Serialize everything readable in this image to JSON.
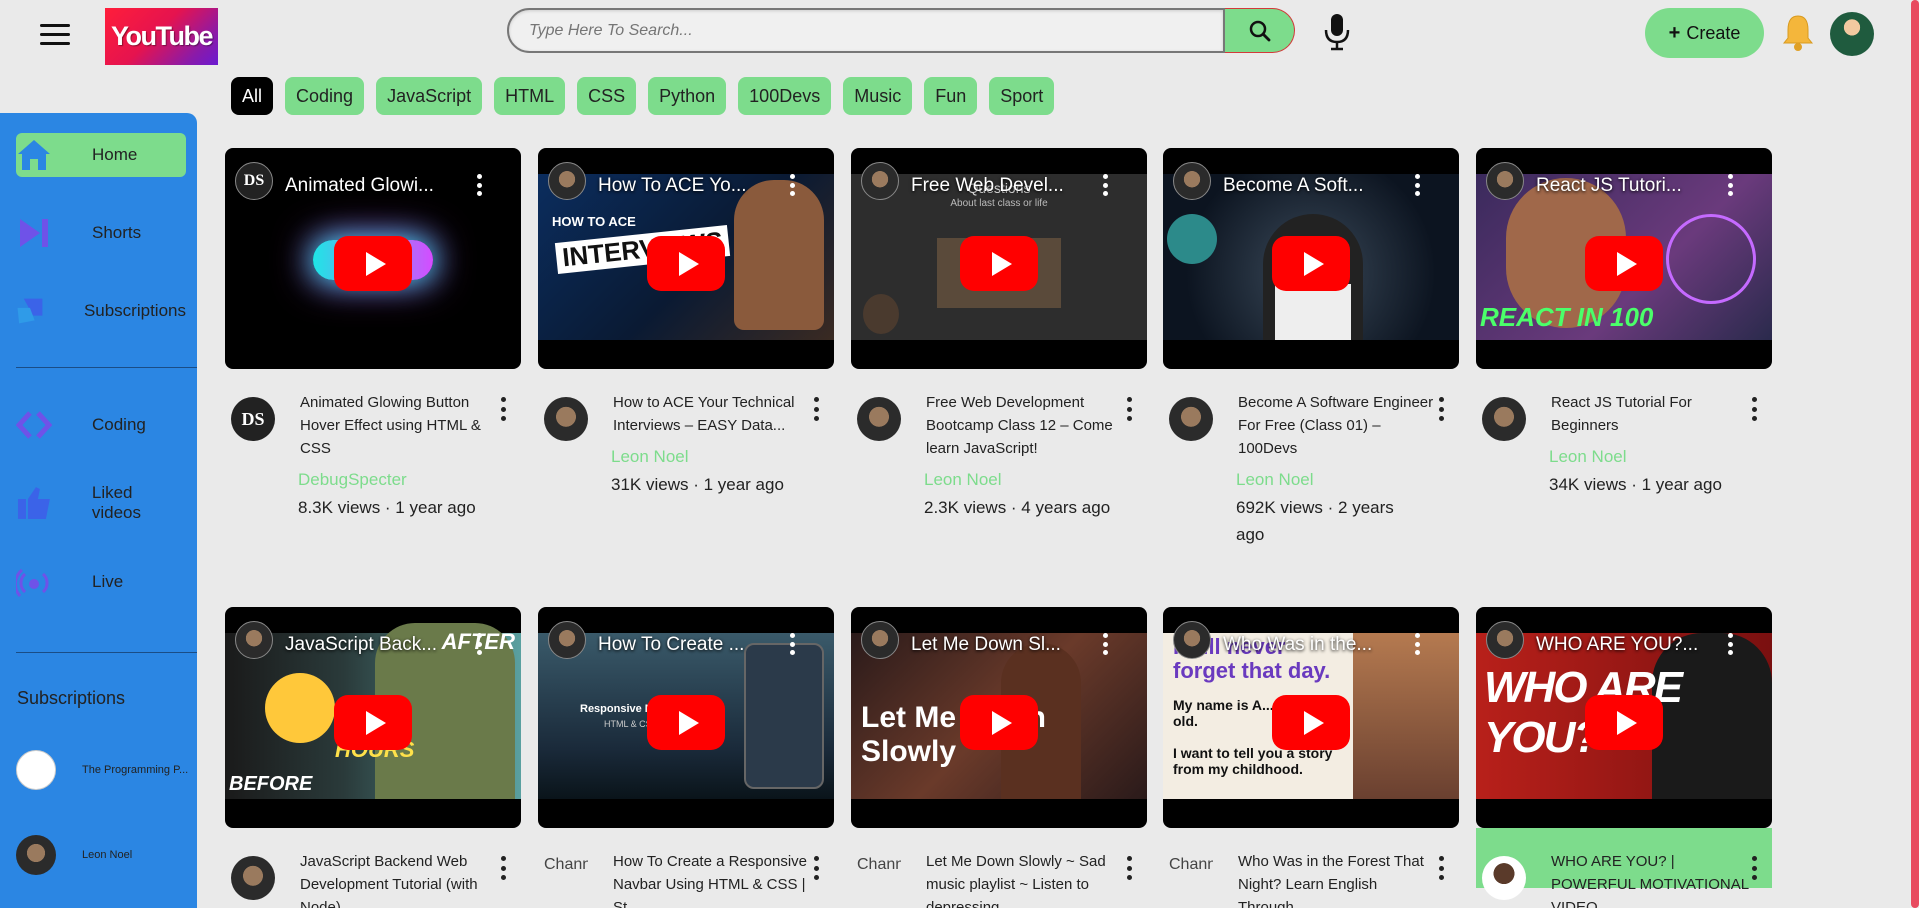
{
  "header": {
    "logo_text": "YouTube",
    "search_placeholder": "Type Here To Search...",
    "create_label": "Create"
  },
  "chips": [
    "All",
    "Coding",
    "JavaScript",
    "HTML",
    "CSS",
    "Python",
    "100Devs",
    "Music",
    "Fun",
    "Sport"
  ],
  "sidebar": {
    "items": [
      {
        "label": "Home"
      },
      {
        "label": "Shorts"
      },
      {
        "label": "Subscriptions"
      },
      {
        "label": "Coding"
      },
      {
        "label": "Liked videos"
      },
      {
        "label": "Live"
      }
    ],
    "subscriptions_title": "Subscriptions",
    "subscriptions": [
      {
        "label": "The Programming P..."
      },
      {
        "label": "Leon Noel"
      }
    ]
  },
  "videos": [
    {
      "thumb_title": "Animated Glowi...",
      "title": "Animated Glowing Button Hover Effect using HTML & CSS",
      "channel": "DebugSpecter",
      "stats": "8.3K views · 1 year ago",
      "channel_avatar_text": "DS"
    },
    {
      "thumb_title": "How To ACE Yo...",
      "title": "How to ACE Your Technical Interviews – EASY Data...",
      "channel": "Leon Noel",
      "stats": "31K views · 1 year ago"
    },
    {
      "thumb_title": "Free Web Devel...",
      "title": "Free Web Development Bootcamp Class 12 – Come learn JavaScript!",
      "channel": "Leon Noel",
      "stats": "2.3K views · 4 years ago"
    },
    {
      "thumb_title": "Become A Soft...",
      "title": "Become A Software Engineer For Free (Class 01) – 100Devs",
      "channel": "Leon Noel",
      "stats": "692K views · 2 years ago"
    },
    {
      "thumb_title": "React JS Tutori...",
      "title": "React JS Tutorial For Beginners",
      "channel": "Leon Noel",
      "stats": "34K views · 1 year ago"
    },
    {
      "thumb_title": "JavaScript Back...",
      "title": "JavaScript Backend Web Development Tutorial (with Node)",
      "channel": "",
      "stats": ""
    },
    {
      "thumb_title": "How To Create ...",
      "title": "How To Create a Responsive Navbar Using HTML & CSS | St...",
      "channel": "",
      "stats": "",
      "channel_avatar_text": "Chann"
    },
    {
      "thumb_title": "Let Me Down Sl...",
      "title": "Let Me Down Slowly ~ Sad music playlist ~ Listen to depressing...",
      "channel": "",
      "stats": "",
      "channel_avatar_text": "Chann"
    },
    {
      "thumb_title": "Who Was in the...",
      "title": "Who Was in the Forest That Night? Learn English Through...",
      "channel": "",
      "stats": "",
      "channel_avatar_text": "Chann"
    },
    {
      "thumb_title": "WHO ARE YOU?...",
      "title": "WHO ARE YOU? | POWERFUL MOTIVATIONAL VIDEO",
      "channel": "",
      "stats": ""
    }
  ],
  "thumb_texts": {
    "v1": "HOW TO ACE",
    "v1b": "INTERVIEWS",
    "v2a": "Questions",
    "v2b": "About last class or life",
    "v4": "REACT IN 100",
    "v5a": "AFTER",
    "v5b": "HOURS",
    "v5c": "BEFORE",
    "v6a": "Responsive Navbar",
    "v6b": "HTML & CSS",
    "v7": "Let Me Down Slowly",
    "v8a": "I will never forget that day.",
    "v8b": "My name is A... 25 years old.",
    "v8c": "I want to tell you a story from my childhood.",
    "v9": "WHO ARE YOU?"
  },
  "colors": {
    "accent_green": "#7ddc8c",
    "sidebar_blue": "#2b86e3",
    "play_red": "#ff0000",
    "page_bg": "#eaeaea"
  },
  "icons": [
    "menu-icon",
    "search-icon",
    "mic-icon",
    "plus-icon",
    "bell-icon",
    "home-icon",
    "shorts-icon",
    "subscriptions-icon",
    "coding-icon",
    "liked-icon",
    "live-icon",
    "more-vert-icon",
    "play-icon"
  ]
}
